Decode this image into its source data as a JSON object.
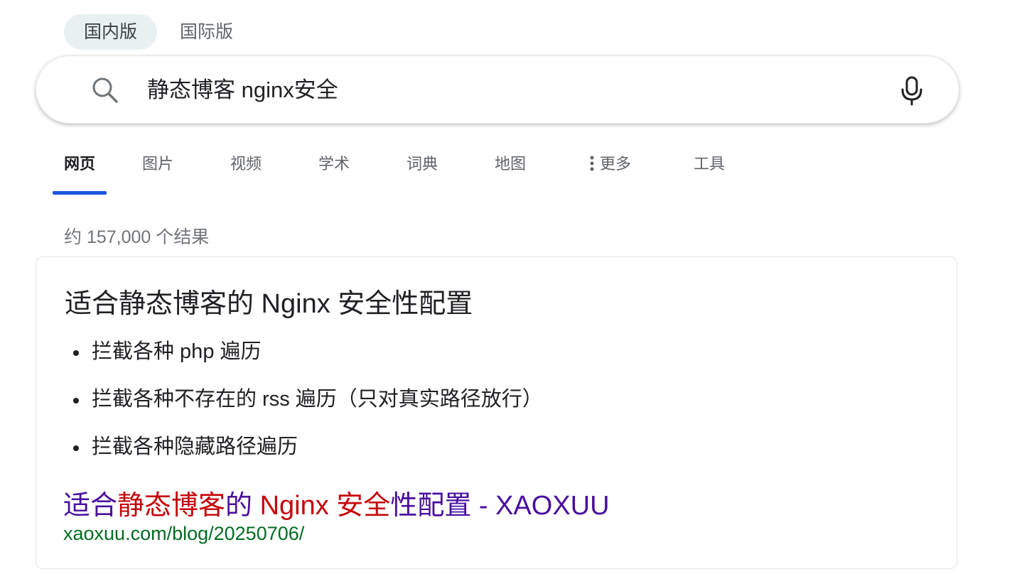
{
  "market": {
    "tabs": [
      {
        "label": "国内版",
        "active": true
      },
      {
        "label": "国际版",
        "active": false
      }
    ]
  },
  "search": {
    "query": "静态博客 nginx安全",
    "icon": "search-icon",
    "mic_icon": "microphone-icon"
  },
  "nav": {
    "tabs": [
      {
        "label": "网页",
        "active": true
      },
      {
        "label": "图片"
      },
      {
        "label": "视频"
      },
      {
        "label": "学术"
      },
      {
        "label": "词典"
      },
      {
        "label": "地图"
      },
      {
        "label": "更多",
        "icon": "more-vertical-icon"
      },
      {
        "label": "工具"
      }
    ]
  },
  "results": {
    "count_text": "约 157,000 个结果",
    "card": {
      "title": "适合静态博客的 Nginx 安全性配置",
      "bullets": [
        "拦截各种 php 遍历",
        "拦截各种不存在的 rss 遍历（只对真实路径放行）",
        "拦截各种隐藏路径遍历"
      ],
      "link_parts": [
        "适合",
        "静态博客",
        "的 ",
        "Nginx 安全",
        "性配置 - XAOXUU"
      ],
      "url": "xaoxuu.com/blog/20250706/"
    }
  },
  "colors": {
    "accent": "#1a56db",
    "link_visited": "#4a0f9f",
    "link_highlight": "#c5050c",
    "url_green": "#006d21"
  }
}
